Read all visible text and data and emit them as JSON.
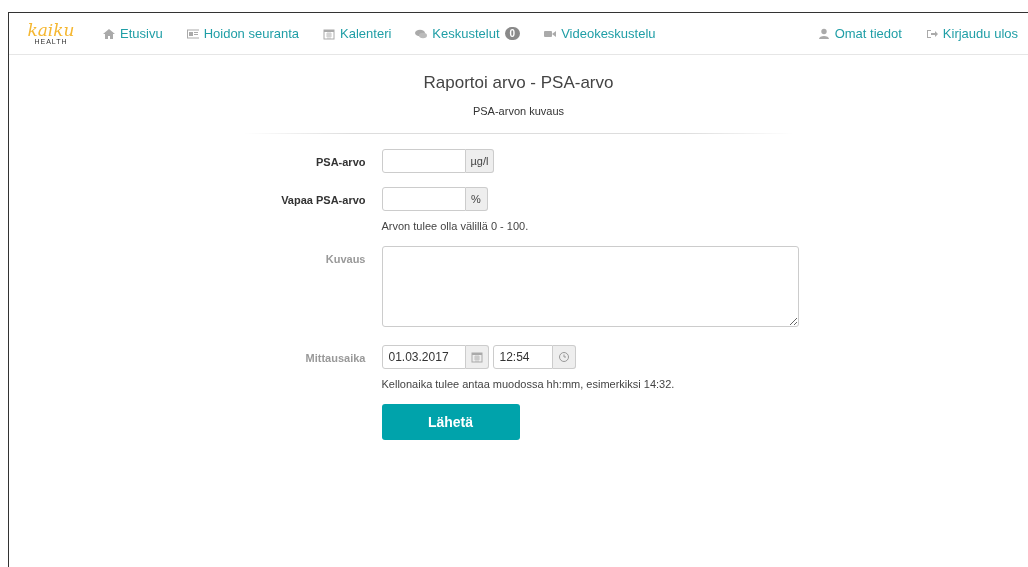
{
  "logo": {
    "name": "kaiku",
    "tagline": "HEALTH"
  },
  "nav": {
    "left": [
      {
        "label": "Etusivu",
        "kind": "home"
      },
      {
        "label": "Hoidon seuranta",
        "kind": "card"
      },
      {
        "label": "Kalenteri",
        "kind": "calendar"
      },
      {
        "label": "Keskustelut",
        "kind": "chat",
        "badge": "0"
      },
      {
        "label": "Videokeskustelu",
        "kind": "video"
      }
    ],
    "right": [
      {
        "label": "Omat tiedot",
        "kind": "user"
      },
      {
        "label": "Kirjaudu ulos",
        "kind": "logout"
      }
    ]
  },
  "title": "Raportoi arvo - PSA-arvo",
  "subtitle": "PSA-arvon kuvaus",
  "fields": [
    {
      "kind": "unit",
      "label": "PSA-arvo",
      "required": true,
      "unit": "µg/l"
    },
    {
      "kind": "unit",
      "label": "Vapaa PSA-arvo",
      "required": true,
      "unit": "%",
      "help": "Arvon tulee olla välillä 0 - 100."
    },
    {
      "kind": "textarea",
      "label": "Kuvaus",
      "required": false
    },
    {
      "kind": "datetime",
      "label": "Mittausaika",
      "required": false,
      "date": "01.03.2017",
      "time": "12:54",
      "help": "Kellonaika tulee antaa muodossa hh:mm, esimerkiksi 14:32."
    }
  ],
  "submit": "Lähetä"
}
